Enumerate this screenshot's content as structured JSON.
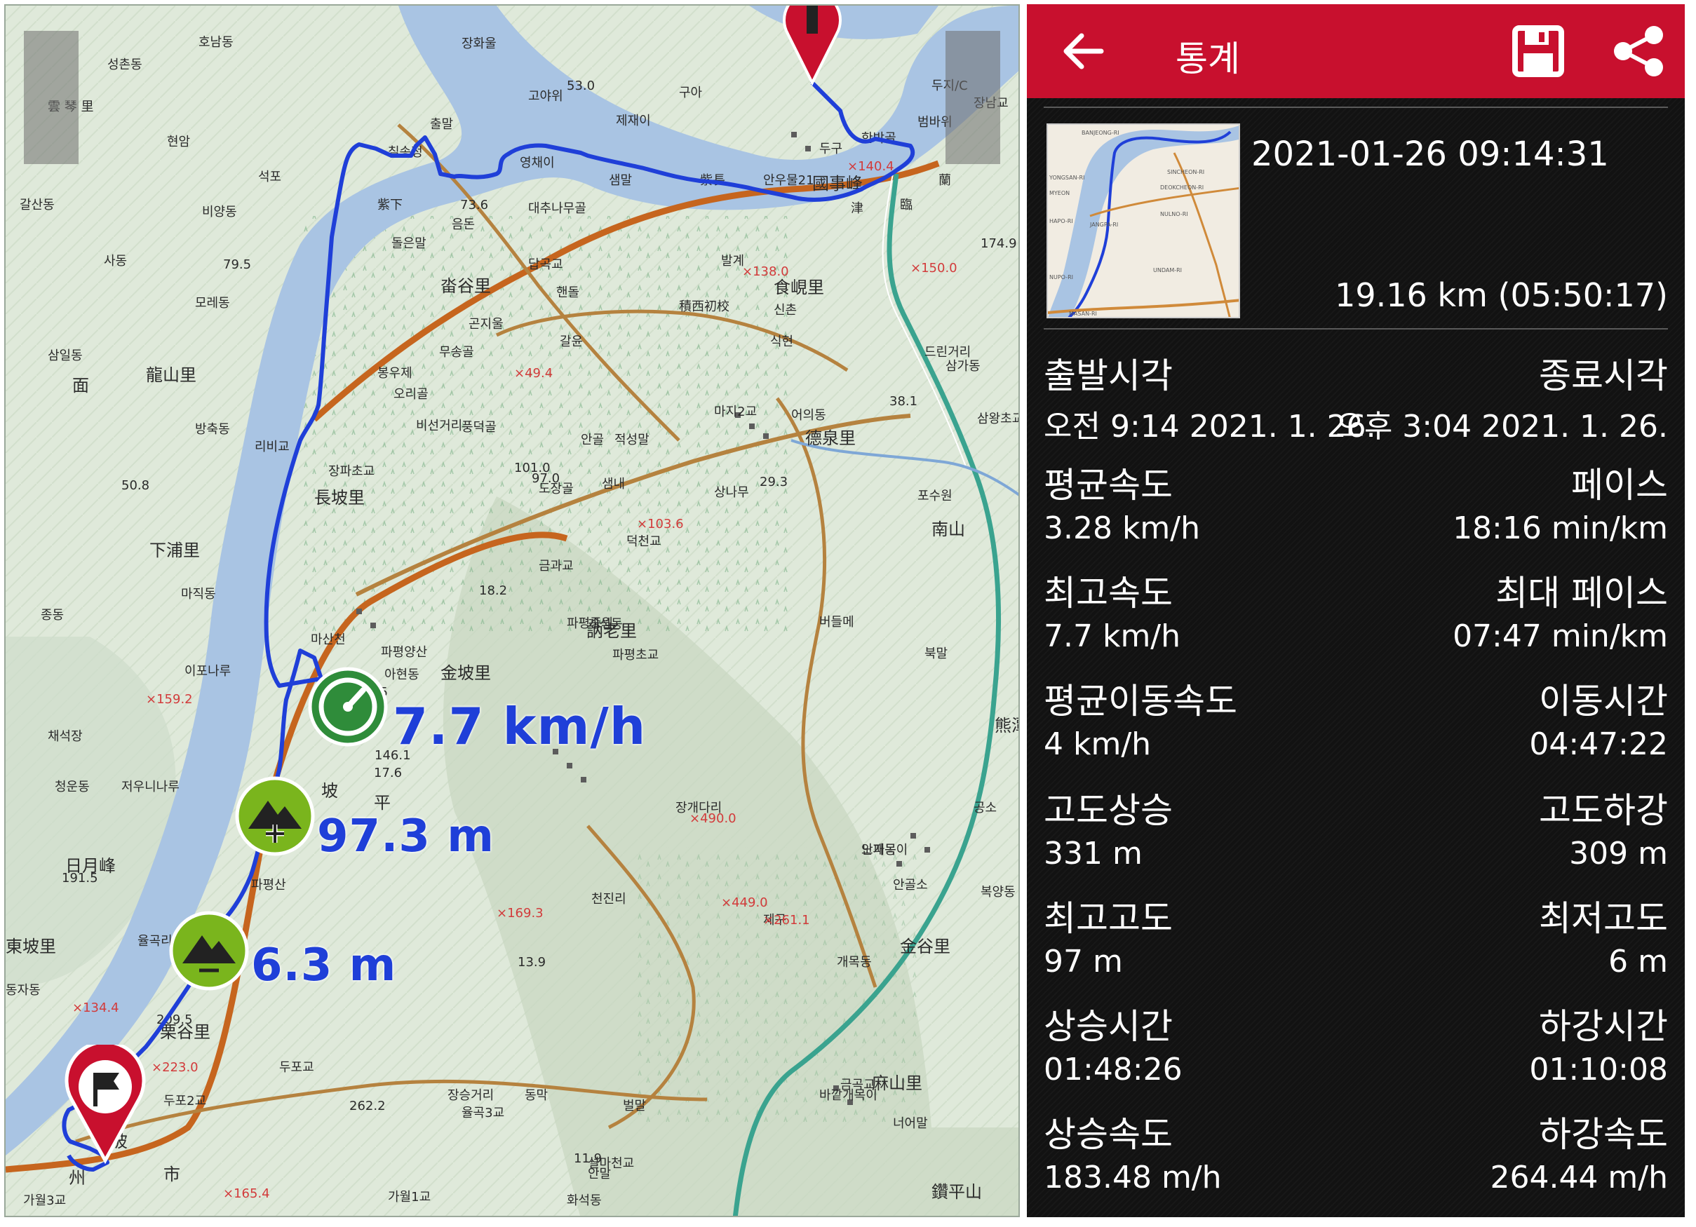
{
  "map": {
    "speed_label": "7.7 km/h",
    "max_alt_label": "97.3 m",
    "min_alt_label": "6.3 m",
    "colors": {
      "track": "#1f3fd8",
      "road_major": "#c6651e",
      "road_minor": "#b5823f",
      "highway": "#3aa38f",
      "river": "#a9c4e3"
    },
    "place_labels": [
      "호남동",
      "성촌동",
      "雲 琴 里",
      "현암",
      "석포",
      "갈산동",
      "비양동",
      "사동",
      "79.5",
      "모레동",
      "삼일동",
      "龍山里",
      "面",
      "방축동",
      "리비교",
      "50.8",
      "下浦里",
      "마직동",
      "종동",
      "이포나루",
      "×159.2",
      "채석장",
      "청운동",
      "저우니나루",
      "日月峰",
      "191.5",
      "東坡里",
      "동자동",
      "×134.4",
      "장화울",
      "53.0",
      "고야위",
      "제재이",
      "구아",
      "출말",
      "칠송정",
      "영채이",
      "샘말",
      "紫長",
      "대추나무골",
      "紫下",
      "73.6",
      "음돈",
      "돌은말",
      "답곡교",
      "畓谷里",
      "핸돌",
      "곤지울",
      "무송골",
      "갈윤",
      "봉우제",
      "×49.4",
      "오리골",
      "비선거리",
      "풍덕골",
      "안골",
      "적성말",
      "101.0",
      "97.0",
      "도장골",
      "샘내",
      "29.3",
      "장파초교",
      "長坡里",
      "상나무",
      "×103.6",
      "덕천교",
      "마산천",
      "금과교",
      "18.2",
      "개석동",
      "訥老里",
      "파평초교",
      "파평양산",
      "파평중원",
      "아현동",
      "金坡里",
      "45.5",
      "146.1",
      "17.6",
      "坡",
      "平",
      "面",
      "파평산",
      "×169.3",
      "×449.0",
      "×490.0",
      "제구",
      "×261.1",
      "천진리",
      "장개다리",
      "13.9",
      "율곡리",
      "209.5",
      "栗谷里",
      "×223.0",
      "두포교",
      "두포2교",
      "麻山里",
      "동막",
      "벌말",
      "장승거리",
      "262.2",
      "율곡3교",
      "11.9",
      "안말",
      "坡",
      "州",
      "市",
      "×165.4",
      "화석동",
      "鑽平山",
      "가월1교",
      "가월3교",
      "설마천교",
      "두지/C",
      "장남교",
      "범바위",
      "한박골",
      "두구",
      "蘭",
      "臨",
      "津",
      "×140.4",
      "안우물21",
      "國事峰",
      "×150.0",
      "174.9",
      "발계",
      "×138.0",
      "食峴里",
      "신촌",
      "積西初校",
      "식현",
      "38.1",
      "드린거리",
      "삼가동",
      "삼왕초교",
      "마지2교",
      "어의동",
      "德泉里",
      "포수원",
      "南山",
      "버들메",
      "북말",
      "熊潭里",
      "공소",
      "노파동",
      "안골소",
      "복양동",
      "개목동",
      "金谷里",
      "안개목이",
      "바깥개목이",
      "금곡교",
      "너어말"
    ]
  },
  "stats": {
    "title": "통계",
    "datetime": "2021-01-26 09:14:31",
    "summary": "19.16 km (05:50:17)",
    "rows": [
      {
        "left_label": "출발시각",
        "right_label": "종료시각",
        "left_value": "오전 9:14 2021. 1. 26.",
        "right_value": "오후 3:04 2021. 1. 26."
      },
      {
        "left_label": "평균속도",
        "right_label": "페이스",
        "left_value": "3.28 km/h",
        "right_value": "18:16 min/km"
      },
      {
        "left_label": "최고속도",
        "right_label": "최대 페이스",
        "left_value": "7.7 km/h",
        "right_value": "07:47 min/km"
      },
      {
        "left_label": "평균이동속도",
        "right_label": "이동시간",
        "left_value": "4 km/h",
        "right_value": "04:47:22"
      },
      {
        "left_label": "고도상승",
        "right_label": "고도하강",
        "left_value": "331 m",
        "right_value": "309 m"
      },
      {
        "left_label": "최고고도",
        "right_label": "최저고도",
        "left_value": "97 m",
        "right_value": "6 m"
      },
      {
        "left_label": "상승시간",
        "right_label": "하강시간",
        "left_value": "01:48:26",
        "right_value": "01:10:08"
      },
      {
        "left_label": "상승속도",
        "right_label": "하강속도",
        "left_value": "183.48 m/h",
        "right_value": "264.44 m/h"
      }
    ],
    "thumbnail_labels": [
      "BANJEONG-RI",
      "YONGSAN-RI",
      "MYEON",
      "HAPO-RI",
      "NUPO-RI",
      "SINCHEON-RI",
      "DEOKCHEON-RI",
      "NULNO-RI",
      "UNDAM-RI",
      "JANGPA-RI",
      "MASAN-RI"
    ],
    "icons": {
      "back": "arrow-left-icon",
      "save": "floppy-disk-icon",
      "share": "share-icon"
    },
    "colors": {
      "topbar": "#c8102e",
      "background": "#121212",
      "text": "#ffffff"
    }
  }
}
